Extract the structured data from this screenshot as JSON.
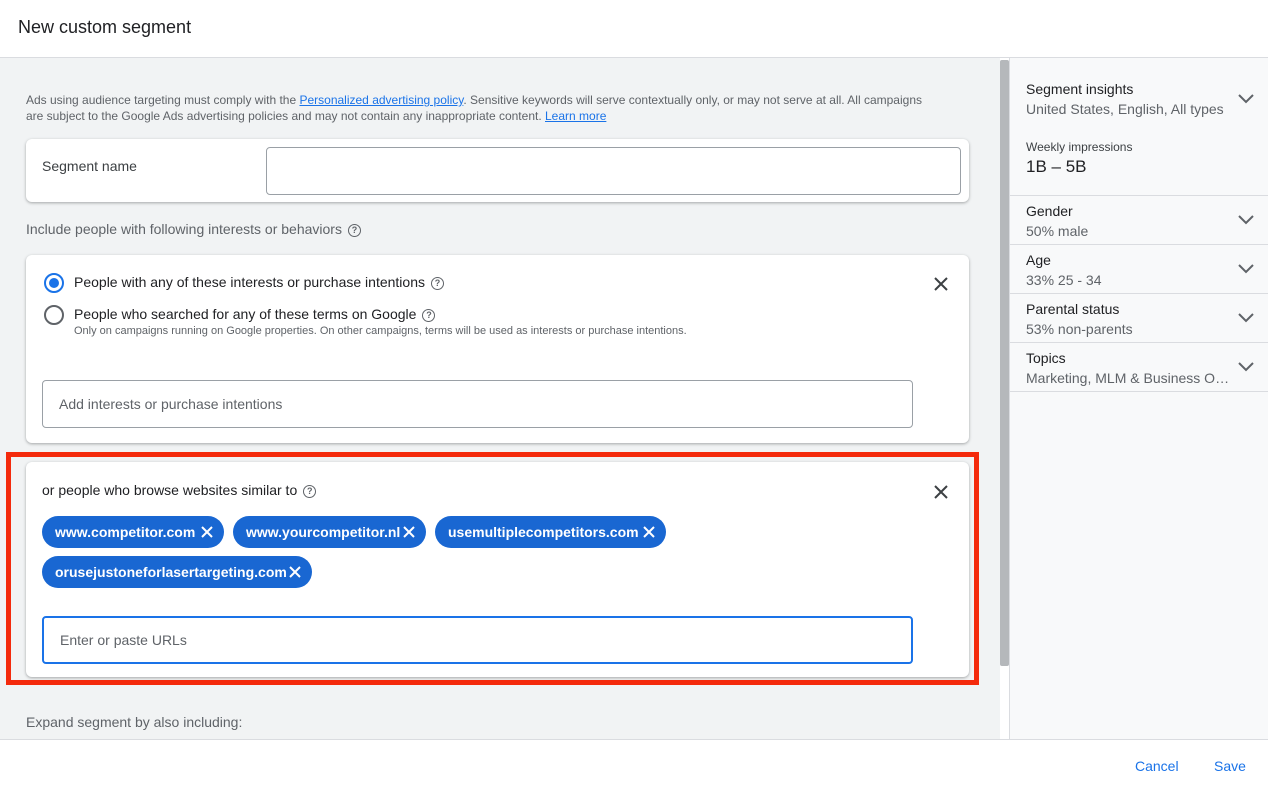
{
  "header": {
    "title": "New custom segment"
  },
  "policy": {
    "text_before": "Ads using audience targeting must comply with the ",
    "link1": "Personalized advertising policy",
    "text_middle": ". Sensitive keywords will serve contextually only, or may not serve at all. All campaigns are subject to the Google Ads advertising policies and may not contain any inappropriate content. ",
    "link2": "Learn more"
  },
  "segment_name": {
    "label": "Segment name",
    "value": ""
  },
  "include": {
    "label": "Include people with following interests or behaviors"
  },
  "interests_card": {
    "option1": "People with any of these interests or purchase intentions",
    "option2": "People who searched for any of these terms on Google",
    "option2_note": "Only on campaigns running on Google properties. On other campaigns, terms will be used as interests or purchase intentions.",
    "selected_option": 1,
    "input_placeholder": "Add interests or purchase intentions"
  },
  "websites_card": {
    "label": "or people who browse websites similar to",
    "chips": [
      "www.competitor.com",
      "www.yourcompetitor.nl",
      "usemultiplecompetitors.com",
      "orusejustoneforlasertargeting.com"
    ],
    "input_placeholder": "Enter or paste URLs"
  },
  "expand": {
    "label": "Expand segment by also including:"
  },
  "sidebar": {
    "insights_title": "Segment insights",
    "insights_sub": "United States, English, All types",
    "impressions_label": "Weekly impressions",
    "impressions_value": "1B – 5B",
    "sections": [
      {
        "title": "Gender",
        "value": "50% male"
      },
      {
        "title": "Age",
        "value": "33% 25 - 34"
      },
      {
        "title": "Parental status",
        "value": "53% non-parents"
      },
      {
        "title": "Topics",
        "value": "Marketing, MLM & Business Opportunities"
      }
    ]
  },
  "footer": {
    "cancel": "Cancel",
    "save": "Save"
  },
  "colors": {
    "accent": "#1a73e8",
    "chip": "#1967d2",
    "highlight": "#f42a0c"
  },
  "icons": [
    "help-icon",
    "close-icon",
    "chip-remove-icon",
    "chevron-down-icon"
  ]
}
